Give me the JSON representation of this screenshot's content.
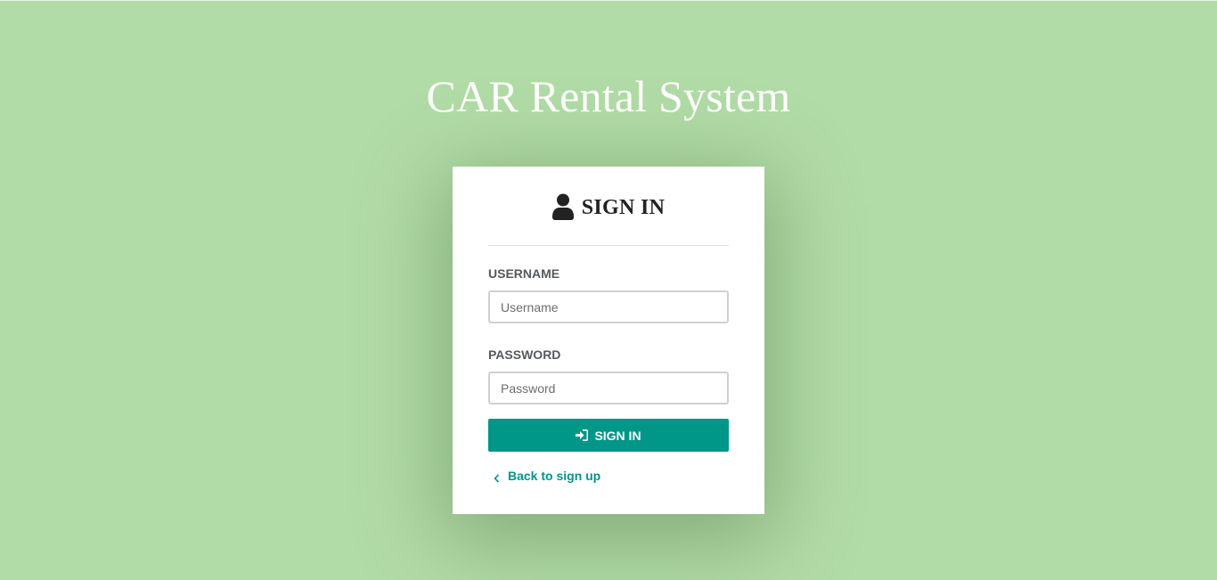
{
  "page": {
    "title": "CAR Rental System",
    "background_color": "#b2dca7"
  },
  "login_card": {
    "heading": "SIGN IN",
    "heading_icon": "user-icon",
    "username": {
      "label": "USERNAME",
      "placeholder": "Username",
      "value": ""
    },
    "password": {
      "label": "PASSWORD",
      "placeholder": "Password",
      "value": ""
    },
    "submit": {
      "label": "SIGN IN",
      "icon": "sign-in-icon",
      "color": "#009688"
    },
    "back_link": {
      "label": "Back to sign up",
      "icon": "chevron-left-icon",
      "color": "#00968a"
    }
  }
}
